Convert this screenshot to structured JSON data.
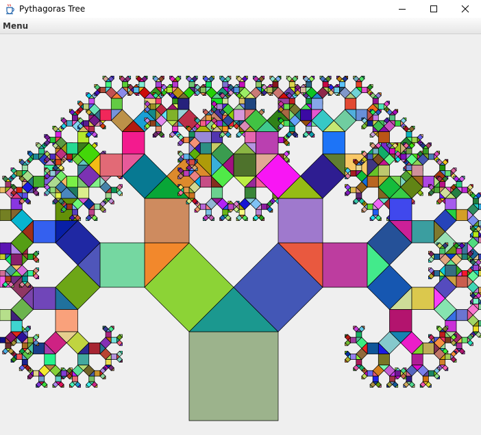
{
  "window": {
    "title": "Pythagoras Tree",
    "icons": {
      "app": "java-cup-icon",
      "minimize": "minimize-icon",
      "maximize": "maximize-icon",
      "close": "close-icon"
    }
  },
  "menubar": {
    "items": [
      {
        "label": "Menu"
      }
    ]
  },
  "canvas": {
    "background": "#efefef",
    "root_color": "#9cb38c",
    "depth": 9
  }
}
